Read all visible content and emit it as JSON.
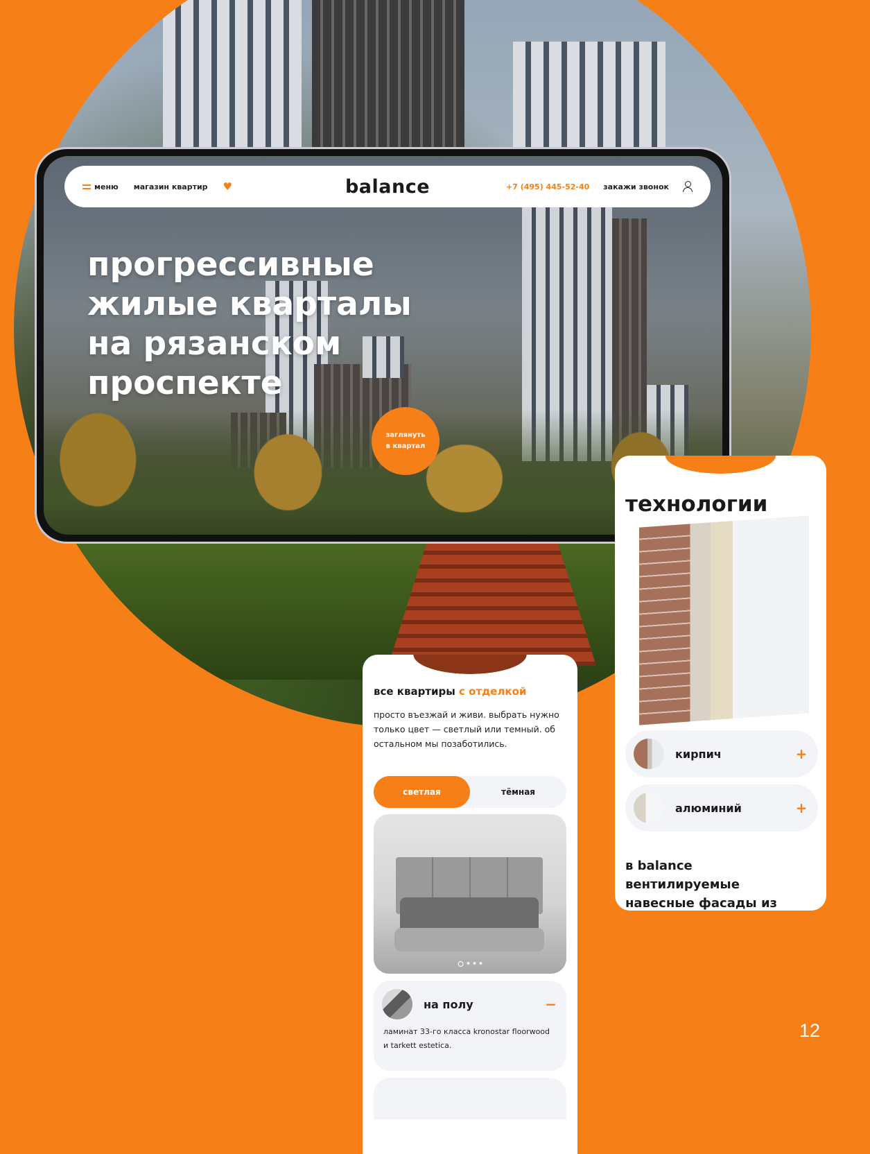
{
  "desktop": {
    "nav": {
      "menu_label": "меню",
      "shop_label": "магазин квартир",
      "logo": "balance",
      "phone": "+7 (495) 445-52-40",
      "callback_label": "закажи звонок"
    },
    "hero": {
      "title": "прогрессивные\nжилые кварталы\nна рязанском\nпроспекте",
      "cta_label": "заглянуть\nв квартал"
    }
  },
  "technology_screen": {
    "title": "технологии",
    "items": [
      {
        "label": "кирпич",
        "state": "collapsed"
      },
      {
        "label": "алюминий",
        "state": "collapsed"
      }
    ],
    "text": "в balance\nвентилируемые\nнавесные фасады из"
  },
  "apartments_screen": {
    "title_main": "все квартиры ",
    "title_accent": "с отделкой",
    "description": "просто въезжай и живи. выбрать нужно только цвет — светлый или темный. об остальном мы позаботились.",
    "toggle": {
      "light": "светлая",
      "dark": "тёмная",
      "active": "light"
    },
    "accordion": {
      "title": "на полу",
      "text": "ламинат 33-го класса kronostar floorwood и tarkett estetica."
    }
  },
  "page_number": "12",
  "colors": {
    "accent": "#f77f17",
    "text": "#1a1a1a",
    "card": "#f3f4f8"
  }
}
